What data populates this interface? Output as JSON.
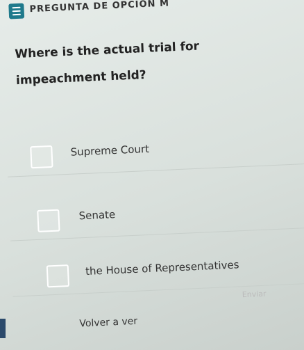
{
  "header": {
    "question_type_label": "PREGUNTA DE OPCIÓN M",
    "icon": "list-icon"
  },
  "question": {
    "text": "Where is the actual trial for impeachment held?"
  },
  "options": [
    {
      "label": "Supreme Court"
    },
    {
      "label": "Senate"
    },
    {
      "label": "the House of Representatives"
    }
  ],
  "footer": {
    "submit_label": "Enviar",
    "back_label": "Volver a ver"
  },
  "colors": {
    "accent": "#1f7a8c",
    "background": "#dfe6e2"
  }
}
